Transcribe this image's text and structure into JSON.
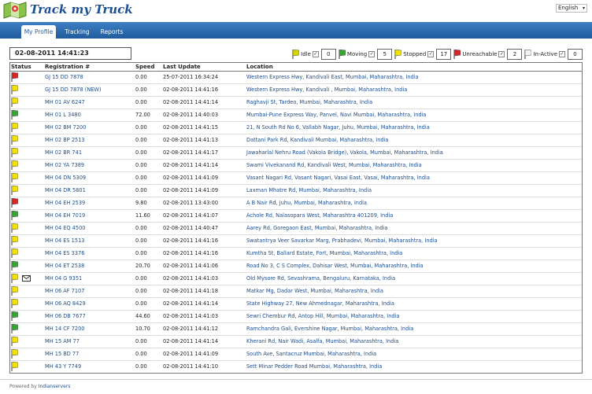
{
  "header": {
    "app_title": "Track my Truck",
    "language": "English"
  },
  "nav": {
    "tabs": [
      {
        "label": "My Profile",
        "active": true
      },
      {
        "label": "Tracking",
        "active": false
      },
      {
        "label": "Reports",
        "active": false
      }
    ]
  },
  "toolbar": {
    "datetime": "02-08-2011 14:41:23",
    "filters": [
      {
        "label": "Idle",
        "color": "#d6d600",
        "checked": true,
        "count": "0"
      },
      {
        "label": "Moving",
        "color": "#39a535",
        "checked": true,
        "count": "5"
      },
      {
        "label": "Stopped",
        "color": "#f2e200",
        "checked": true,
        "count": "17"
      },
      {
        "label": "Unreachable",
        "color": "#d72525",
        "checked": true,
        "count": "2"
      },
      {
        "label": "In-Active",
        "color": "#f4f4f4",
        "checked": true,
        "count": "0"
      }
    ]
  },
  "table": {
    "headers": {
      "status": "Status",
      "registration": "Registration #",
      "speed": "Speed",
      "last_update": "Last Update",
      "location": "Location"
    },
    "rows": [
      {
        "status": "unreachable",
        "reg": "GJ 15 DD 7878",
        "speed": "0.00",
        "update": "25-07-2011 16:34:24",
        "loc": "Western Express Hwy, Kandivali East, Mumbai, Maharashtra, India"
      },
      {
        "status": "stopped",
        "reg": "GJ 15 DD 7878 (NEW)",
        "speed": "0.00",
        "update": "02-08-2011 14:41:16",
        "loc": "Western Express Hwy, Kandivali , Mumbai, Maharashtra, India"
      },
      {
        "status": "stopped",
        "reg": "MH 01 AV 6247",
        "speed": "0.00",
        "update": "02-08-2011 14:41:14",
        "loc": "Raghavji St, Tardeo, Mumbai, Maharashtra, India"
      },
      {
        "status": "moving",
        "reg": "MH 01 L 3480",
        "speed": "72.00",
        "update": "02-08-2011 14:40:03",
        "loc": "Mumbai-Pune Express Way, Panvel, Navi Mumbai, Maharashtra, India"
      },
      {
        "status": "stopped",
        "reg": "MH 02 BM 7200",
        "speed": "0.00",
        "update": "02-08-2011 14:41:15",
        "loc": "21, N South Rd No 6, Vallabh Nagar, Juhu, Mumbai, Maharashtra, India"
      },
      {
        "status": "stopped",
        "reg": "MH 02 BP 2513",
        "speed": "0.00",
        "update": "02-08-2011 14:41:13",
        "loc": "Dattani Park Rd, Kandivali Mumbai, Maharashtra, India"
      },
      {
        "status": "stopped",
        "reg": "MH 02 BR 741",
        "speed": "0.00",
        "update": "02-08-2011 14:41:17",
        "loc": "Jawaharlal Nehru Road (Vakola Bridge), Vakola, Mumbai, Maharashtra, India"
      },
      {
        "status": "stopped",
        "reg": "MH 02 YA 7389",
        "speed": "0.00",
        "update": "02-08-2011 14:41:14",
        "loc": "Swami Vivekanand Rd, Kandivali West, Mumbai, Maharashtra, India"
      },
      {
        "status": "stopped",
        "reg": "MH 04 DN 5309",
        "speed": "0.00",
        "update": "02-08-2011 14:41:09",
        "loc": "Vasant Nagari Rd, Vasant Nagari, Vasai East, Vasai, Maharashtra, India"
      },
      {
        "status": "stopped",
        "reg": "MH 04 DR 5801",
        "speed": "0.00",
        "update": "02-08-2011 14:41:09",
        "loc": "Laxman Mhatre Rd, Mumbai, Maharashtra, India"
      },
      {
        "status": "unreachable",
        "reg": "MH 04 EH 2539",
        "speed": "9.80",
        "update": "02-08-2011 13:43:00",
        "loc": "A B Nair Rd, Juhu, Mumbai, Maharashtra, India"
      },
      {
        "status": "moving",
        "reg": "MH 04 EH 7019",
        "speed": "11.60",
        "update": "02-08-2011 14:41:07",
        "loc": "Achole Rd, Nalasopara West, Maharashtra 401209, India"
      },
      {
        "status": "stopped",
        "reg": "MH 04 EQ 4500",
        "speed": "0.00",
        "update": "02-08-2011 14:40:47",
        "loc": "Aarey Rd, Goregaon East, Mumbai, Maharashtra, India"
      },
      {
        "status": "stopped",
        "reg": "MH 04 ES 1513",
        "speed": "0.00",
        "update": "02-08-2011 14:41:16",
        "loc": "Swatantrya Veer Savarkar Marg, Prabhadevi, Mumbai, Maharashtra, India"
      },
      {
        "status": "stopped",
        "reg": "MH 04 ES 3376",
        "speed": "0.00",
        "update": "02-08-2011 14:41:16",
        "loc": "Kumtha St, Ballard Estate, Fort, Mumbai, Maharashtra, India"
      },
      {
        "status": "moving",
        "reg": "MH 04 ET 2538",
        "speed": "20.70",
        "update": "02-08-2011 14:41:06",
        "loc": "Road No 3, C S Complex, Dahisar West, Mumbai, Maharashtra, India"
      },
      {
        "status": "stopped",
        "reg": "MH 04 G 9351",
        "speed": "0.00",
        "update": "02-08-2011 14:41:03",
        "loc": "Old Mysore Rd, Sevashrama, Bengaluru, Karnataka, India",
        "mail": true
      },
      {
        "status": "stopped",
        "reg": "MH 06 AF 7107",
        "speed": "0.00",
        "update": "02-08-2011 14:41:18",
        "loc": "Matkar Mg, Dadar West, Mumbai, Maharashtra, India"
      },
      {
        "status": "stopped",
        "reg": "MH 06 AQ 8429",
        "speed": "0.00",
        "update": "02-08-2011 14:41:14",
        "loc": "State Highway 27, New Ahmednagar, Maharashtra, India"
      },
      {
        "status": "moving",
        "reg": "MH 06 DB 7677",
        "speed": "44.60",
        "update": "02-08-2011 14:41:03",
        "loc": "Sewri Chembur Rd, Antop Hill, Mumbai, Maharashtra, India"
      },
      {
        "status": "moving",
        "reg": "MH 14 CF 7200",
        "speed": "10.70",
        "update": "02-08-2011 14:41:12",
        "loc": "Ramchandra Gali, Evershine Nagar, Mumbai, Maharashtra, India"
      },
      {
        "status": "stopped",
        "reg": "MH 15 AM 77",
        "speed": "0.00",
        "update": "02-08-2011 14:41:14",
        "loc": "Kherani Rd, Nair Wadi, Asalfa, Mumbai, Maharashtra, India"
      },
      {
        "status": "stopped",
        "reg": "MH 15 BD 77",
        "speed": "0.00",
        "update": "02-08-2011 14:41:09",
        "loc": "South Ave, Santacruz Mumbai, Maharashtra, India"
      },
      {
        "status": "stopped",
        "reg": "MH 43 Y 7749",
        "speed": "0.00",
        "update": "02-08-2011 14:41:10",
        "loc": "Sett Minar Pedder Road Mumbai, Maharashtra, India"
      }
    ]
  },
  "status_colors": {
    "stopped": "#f2e200",
    "moving": "#39a535",
    "unreachable": "#d72525"
  },
  "footer": {
    "prefix": "Powered by",
    "link": "Indianservers"
  }
}
